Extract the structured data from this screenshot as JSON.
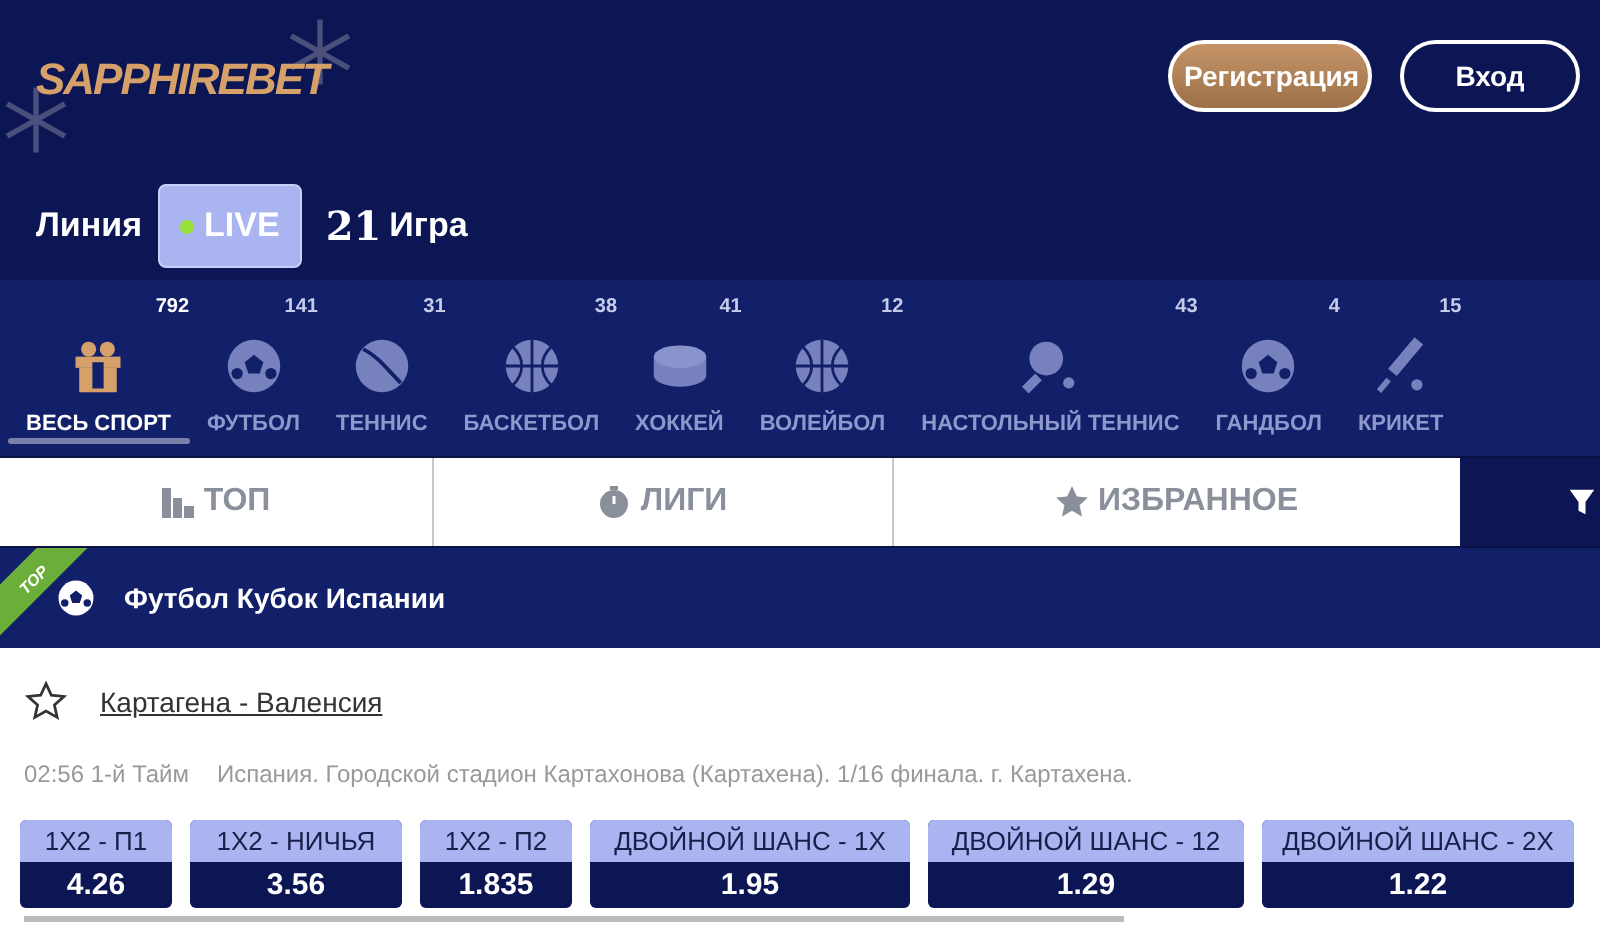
{
  "header": {
    "logo": "SAPPHIREBET",
    "buttons": [
      {
        "label": "Регистрация",
        "kind": "primary"
      },
      {
        "label": "Вход",
        "kind": "outline"
      }
    ]
  },
  "modes": [
    {
      "label": "Линия",
      "selected": false,
      "live": false
    },
    {
      "label": "LIVE",
      "selected": true,
      "live": true
    }
  ],
  "games": {
    "count": "21",
    "label": "Игра"
  },
  "sports": [
    {
      "label": "ВЕСЬ СПОРТ",
      "count": "792",
      "kind": "gift",
      "selected": true
    },
    {
      "label": "ФУТБОЛ",
      "count": "141",
      "kind": "football",
      "selected": false
    },
    {
      "label": "ТЕННИС",
      "count": "31",
      "kind": "tennis",
      "selected": false
    },
    {
      "label": "БАСКЕТБОЛ",
      "count": "38",
      "kind": "basketball",
      "selected": false
    },
    {
      "label": "ХОККЕЙ",
      "count": "41",
      "kind": "hockey",
      "selected": false
    },
    {
      "label": "ВОЛЕЙБОЛ",
      "count": "12",
      "kind": "volleyball",
      "selected": false
    },
    {
      "label": "НАСТОЛЬНЫЙ ТЕННИС",
      "count": "43",
      "kind": "pingpong",
      "selected": false
    },
    {
      "label": "ГАНДБОЛ",
      "count": "4",
      "kind": "handball",
      "selected": false
    },
    {
      "label": "КРИКЕТ",
      "count": "15",
      "kind": "cricket",
      "selected": false
    }
  ],
  "tabs": [
    {
      "label": "ТОП",
      "kind": "top"
    },
    {
      "label": "ЛИГИ",
      "kind": "leagues"
    },
    {
      "label": "ИЗБРАННОЕ",
      "kind": "favorites"
    }
  ],
  "section": {
    "badge": "TOP",
    "title": "Футбол Кубок Испании"
  },
  "match": {
    "title": "Картагена - Валенсия",
    "favorite": false,
    "time": "02:56 1-й Тайм",
    "info": "Испания. Городской стадион Картахонова (Картахена). 1/16 финала. г. Картахена.",
    "odds": [
      {
        "label": "1X2 - П1",
        "value": "4.26"
      },
      {
        "label": "1X2 - НИЧЬЯ",
        "value": "3.56"
      },
      {
        "label": "1X2 - П2",
        "value": "1.835"
      },
      {
        "label": "ДВОЙНОЙ ШАНС - 1X",
        "value": "1.95"
      },
      {
        "label": "ДВОЙНОЙ ШАНС - 12",
        "value": "1.29"
      },
      {
        "label": "ДВОЙНОЙ ШАНС - 2X",
        "value": "1.22"
      }
    ]
  }
}
